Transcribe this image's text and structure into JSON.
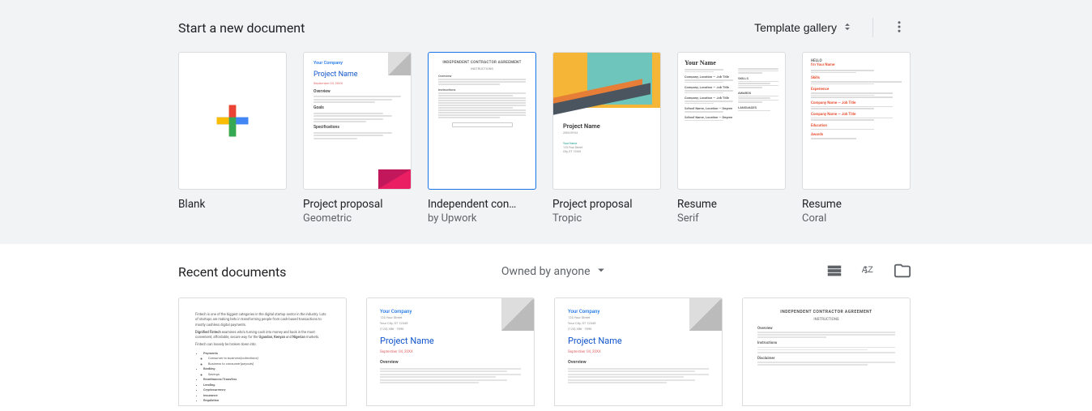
{
  "header": {
    "title": "Start a new document",
    "gallery_label": "Template gallery"
  },
  "templates": [
    {
      "title": "Blank",
      "subtitle": ""
    },
    {
      "title": "Project proposal",
      "subtitle": "Geometric",
      "brand": "Your Company",
      "heading": "Project Name"
    },
    {
      "title": "Independent con…",
      "subtitle": "by Upwork",
      "heading": "INDEPENDENT CONTRACTOR AGREEMENT"
    },
    {
      "title": "Project proposal",
      "subtitle": "Tropic",
      "heading": "Project Name"
    },
    {
      "title": "Resume",
      "subtitle": "Serif",
      "heading": "Your Name"
    },
    {
      "title": "Resume",
      "subtitle": "Coral"
    }
  ],
  "recent": {
    "title": "Recent documents",
    "filter_label": "Owned by anyone"
  },
  "docs": [
    {
      "type": "fintech"
    },
    {
      "type": "proposal",
      "brand": "Your Company",
      "heading": "Project Name",
      "date": "September 04, 20XX",
      "section": "Overview"
    },
    {
      "type": "proposal",
      "brand": "Your Company",
      "heading": "Project Name",
      "date": "September 04, 20XX",
      "section": "Overview"
    },
    {
      "type": "ic",
      "heading": "INDEPENDENT CONTRACTOR AGREEMENT",
      "sub": "INSTRUCTIONS",
      "s1": "Overview",
      "s2": "Instructions",
      "s3": "Disclaimer"
    }
  ]
}
